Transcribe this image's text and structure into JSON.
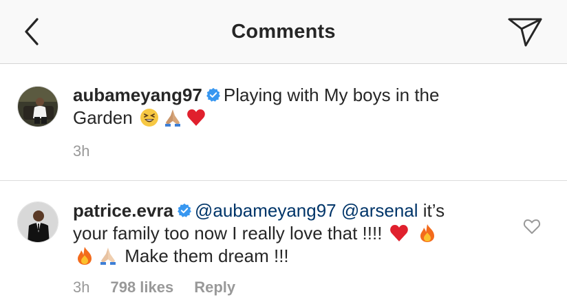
{
  "header": {
    "title": "Comments"
  },
  "caption": {
    "username": "aubameyang97",
    "text_line1": "Playing with My boys in the",
    "text_line2": "Garden",
    "emojis": [
      "grinning-squinting-emoji",
      "folded-hands-emoji",
      "red-heart-emoji"
    ],
    "time": "3h"
  },
  "comment": {
    "username": "patrice.evra",
    "mention1": "@aubameyang97",
    "mention2": "@arsenal",
    "text_a": " it’s",
    "text_line2": "your family too now I really love that !!!! ",
    "text_line3": " Make them dream !!!",
    "emojis": [
      "red-heart-emoji",
      "fire-emoji",
      "fire-emoji",
      "folded-hands-emoji"
    ],
    "time": "3h",
    "likes": "798 likes",
    "reply": "Reply"
  },
  "colors": {
    "text": "#262626",
    "mention": "#003569",
    "meta": "#999999",
    "verified": "#3897f0",
    "header_bg": "#f9f9f9"
  }
}
